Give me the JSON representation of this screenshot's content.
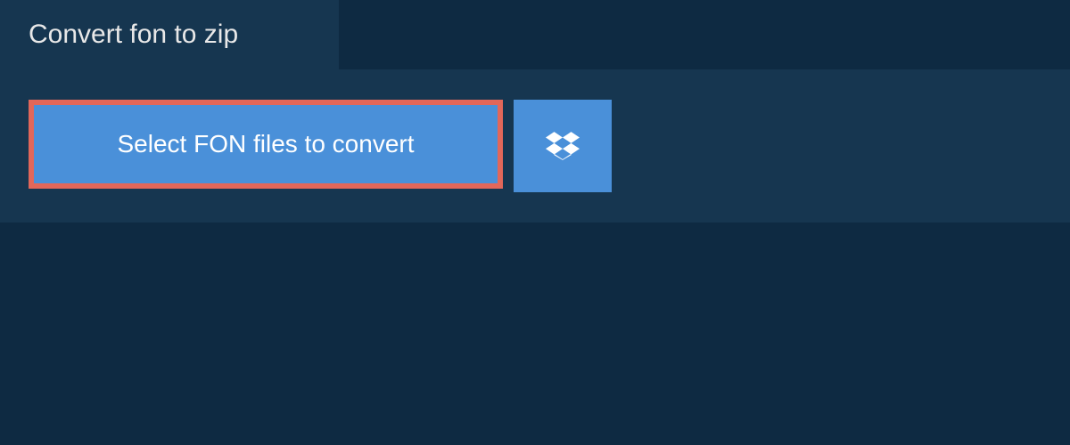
{
  "tab": {
    "label": "Convert fon to zip"
  },
  "actions": {
    "select_label": "Select FON files to convert"
  }
}
